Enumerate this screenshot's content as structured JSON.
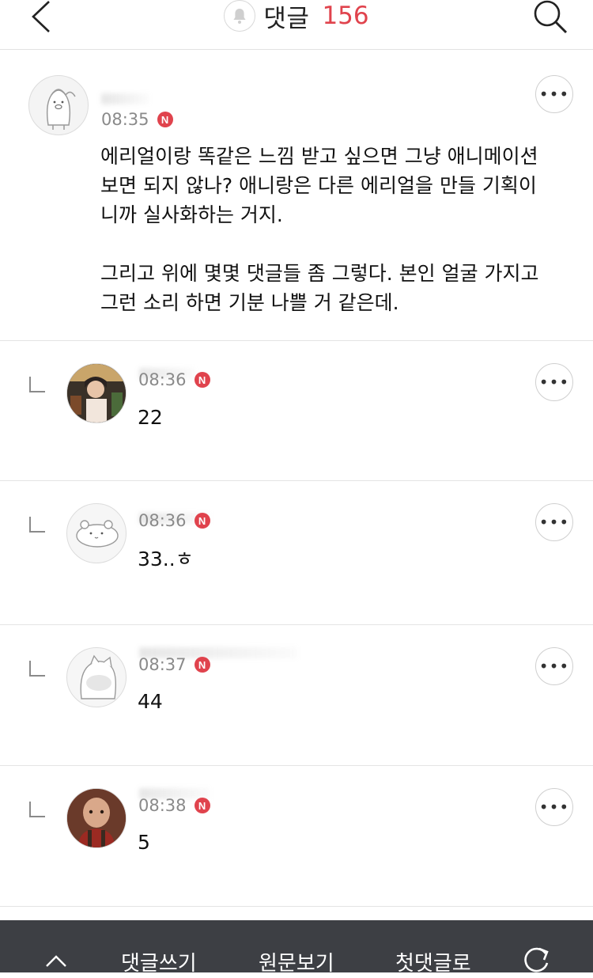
{
  "header": {
    "title": "댓글",
    "count": "156"
  },
  "comments": [
    {
      "time": "08:35",
      "badge": "N",
      "text": "에리얼이랑 똑같은 느낌 받고 싶으면 그냥 애니메이션\n보면 되지 않나? 애니랑은 다른 에리얼을 만들 기획이\n니까 실사화하는 거지.\n\n그리고 위에 몇몇 댓글들 좀 그렇다. 본인 얼굴 가지고\n그런 소리 하면 기분 나쁠 거 같은데.",
      "more_label": "•••"
    },
    {
      "time": "08:36",
      "badge": "N",
      "text": "22",
      "more_label": "•••"
    },
    {
      "time": "08:36",
      "badge": "N",
      "text": "33..ㅎ",
      "more_label": "•••"
    },
    {
      "time": "08:37",
      "badge": "N",
      "text": "44",
      "more_label": "•••"
    },
    {
      "time": "08:38",
      "badge": "N",
      "text": "5",
      "more_label": "•••"
    }
  ],
  "bottom_bar": {
    "write": "댓글쓰기",
    "original": "원문보기",
    "first": "첫댓글로"
  }
}
